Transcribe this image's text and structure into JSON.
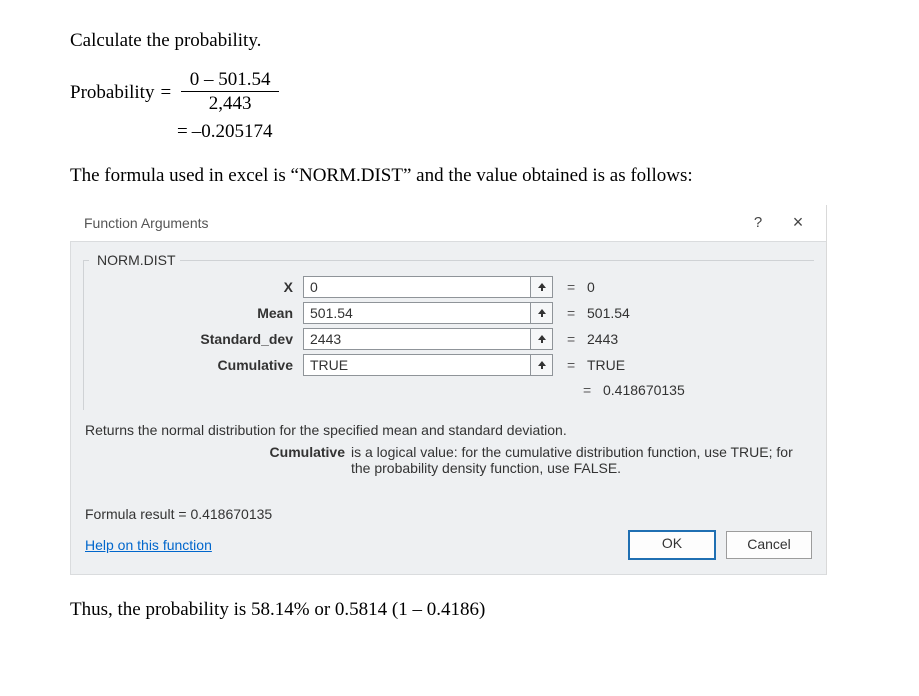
{
  "intro": "Calculate the probability.",
  "math": {
    "label": "Probability",
    "eq": "=",
    "numerator": "0 – 501.54",
    "denominator": "2,443",
    "line2_eq": "=",
    "line2_val": "–0.205174"
  },
  "explain": "The formula used in excel is “NORM.DIST” and the value obtained is as follows:",
  "dialog": {
    "title": "Function Arguments",
    "help_q": "?",
    "close_x": "×",
    "group_legend": "NORM.DIST",
    "args": [
      {
        "label": "X",
        "value": "0",
        "result": "0"
      },
      {
        "label": "Mean",
        "value": "501.54",
        "result": "501.54"
      },
      {
        "label": "Standard_dev",
        "value": "2443",
        "result": "2443"
      },
      {
        "label": "Cumulative",
        "value": "TRUE",
        "result": "TRUE"
      }
    ],
    "eq": "=",
    "func_result": "0.418670135",
    "description": "Returns the normal distribution for the specified mean and standard deviation.",
    "arg_desc_label": "Cumulative",
    "arg_desc_text": "is a logical value: for the cumulative distribution function, use TRUE; for the probability density function, use FALSE.",
    "formula_result_label": "Formula result =  ",
    "formula_result_value": "0.418670135",
    "help_link": "Help on this function",
    "ok": "OK",
    "cancel": "Cancel"
  },
  "closing": "Thus, the probability is 58.14% or 0.5814 (1 – 0.4186)"
}
